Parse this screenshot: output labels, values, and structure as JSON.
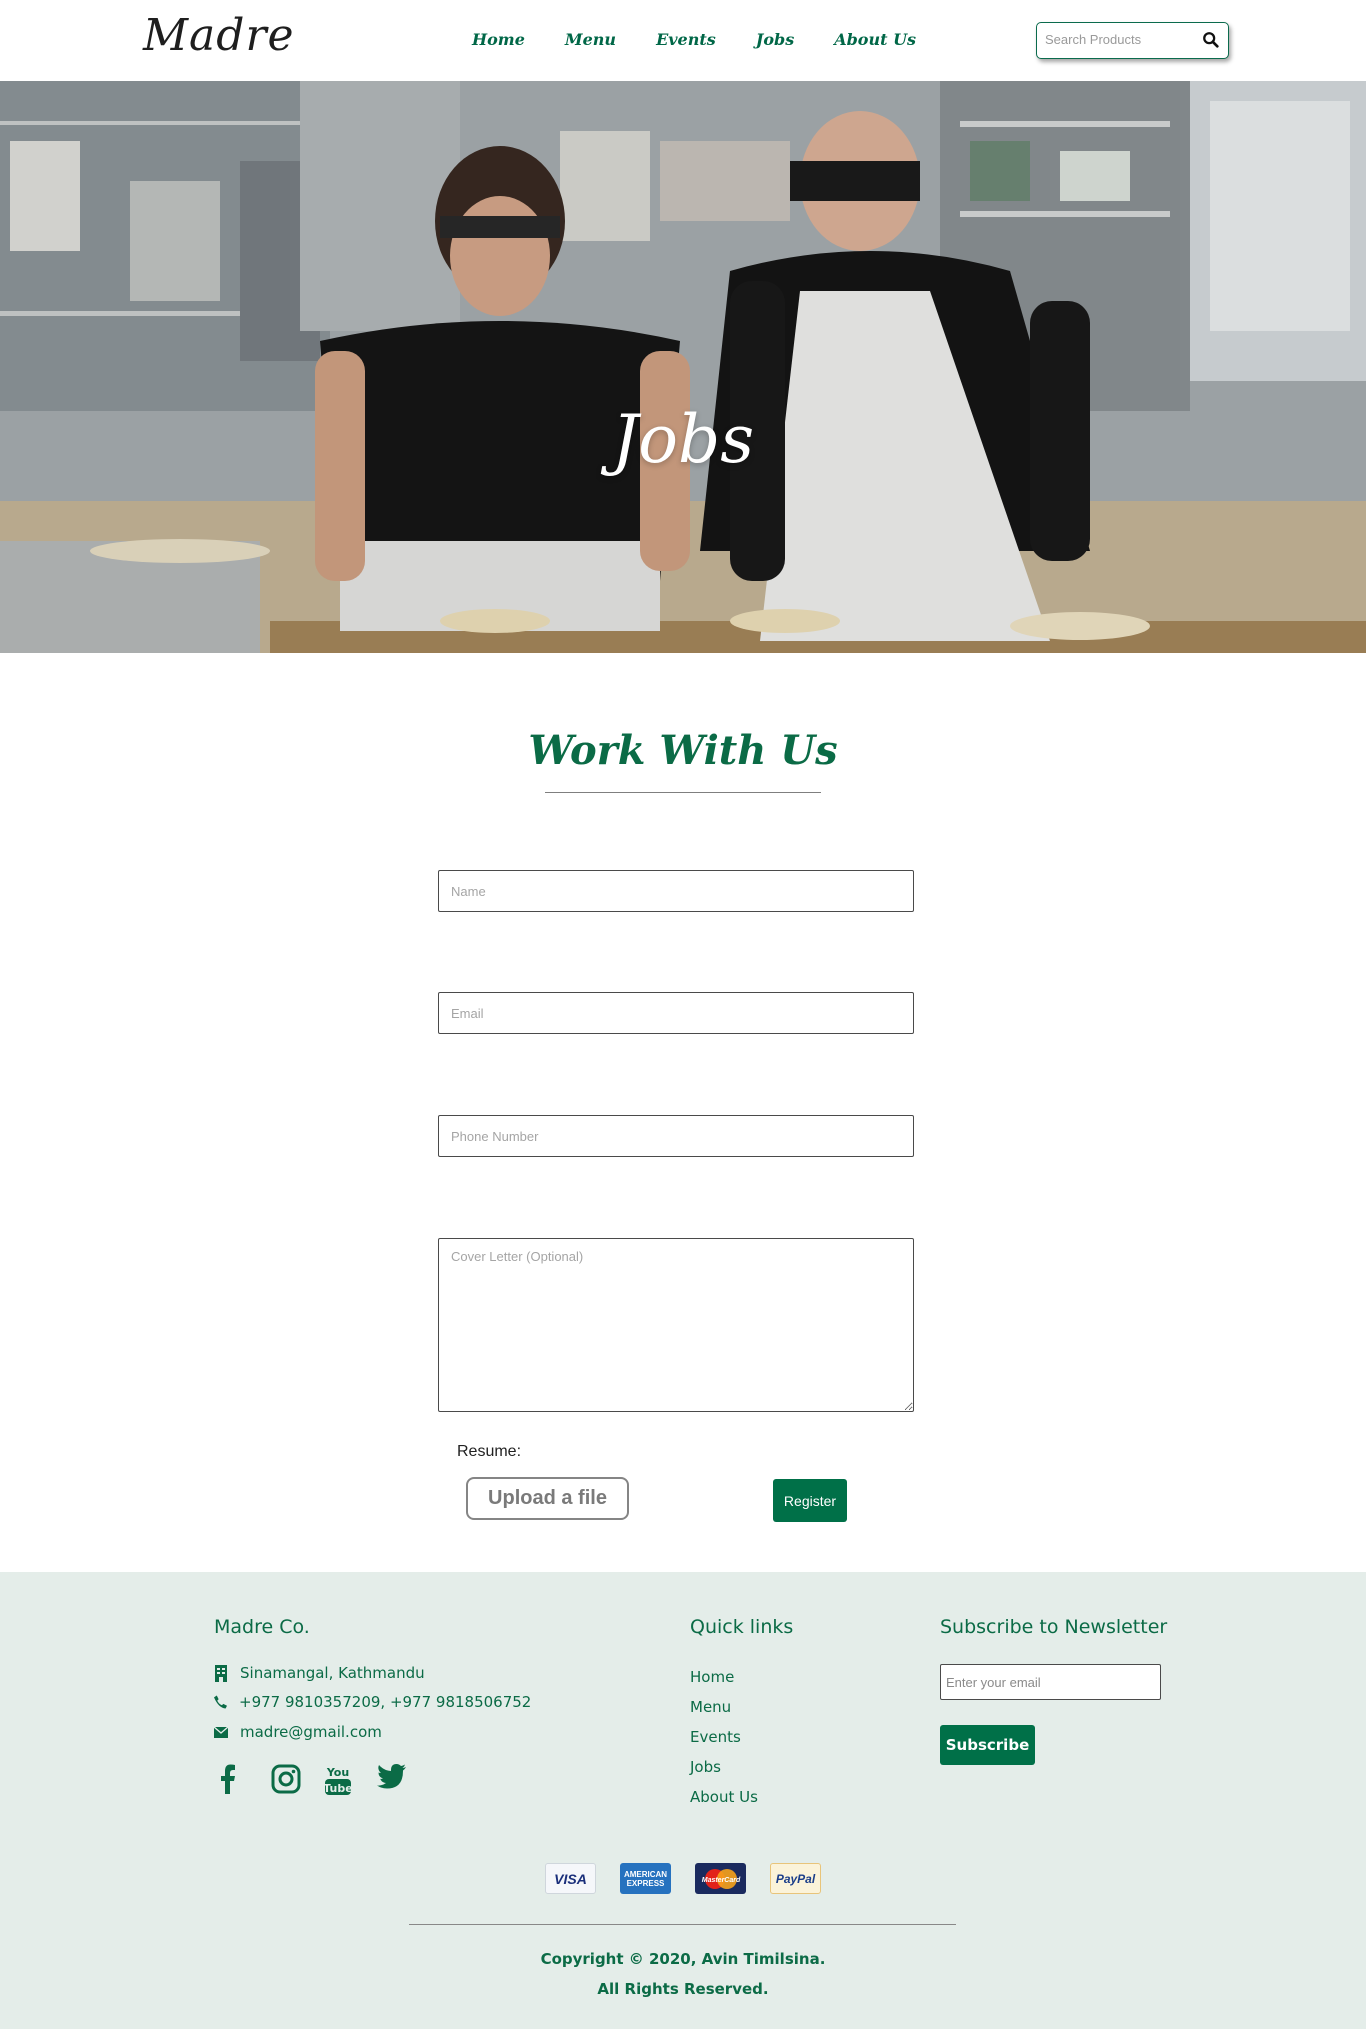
{
  "header": {
    "logo": "Madre",
    "nav": [
      "Home",
      "Menu",
      "Events",
      "Jobs",
      "About Us"
    ],
    "search_placeholder": "Search Products"
  },
  "hero": {
    "title": "Jobs"
  },
  "form": {
    "title": "Work With Us",
    "name_placeholder": "Name",
    "email_placeholder": "Email",
    "phone_placeholder": "Phone Number",
    "cover_placeholder": "Cover Letter (Optional)",
    "resume_label": "Resume:",
    "upload_label": "Upload a file",
    "register_label": "Register"
  },
  "footer": {
    "company": {
      "heading": "Madre Co.",
      "address": "Sinamangal, Kathmandu",
      "phone": "+977 9810357209, +977 9818506752",
      "email": "madre@gmail.com",
      "social": [
        "facebook-icon",
        "instagram-icon",
        "youtube-icon",
        "twitter-icon"
      ]
    },
    "quick_links": {
      "heading": "Quick links",
      "items": [
        "Home",
        "Menu",
        "Events",
        "Jobs",
        "About Us"
      ]
    },
    "newsletter": {
      "heading": "Subscribe to Newsletter",
      "placeholder": "Enter your email",
      "button": "Subscribe"
    },
    "payments": {
      "visa": "VISA",
      "amex": "AMERICAN EXPRESS",
      "mastercard": "MasterCard",
      "paypal": "PayPal"
    },
    "copyright": {
      "line1": "Copyright © 2020, Avin Timilsina.",
      "line2": "All Rights Reserved."
    }
  },
  "colors": {
    "brand_green": "#0b6b46",
    "button_green": "#007048",
    "footer_bg": "#e4ede9"
  }
}
